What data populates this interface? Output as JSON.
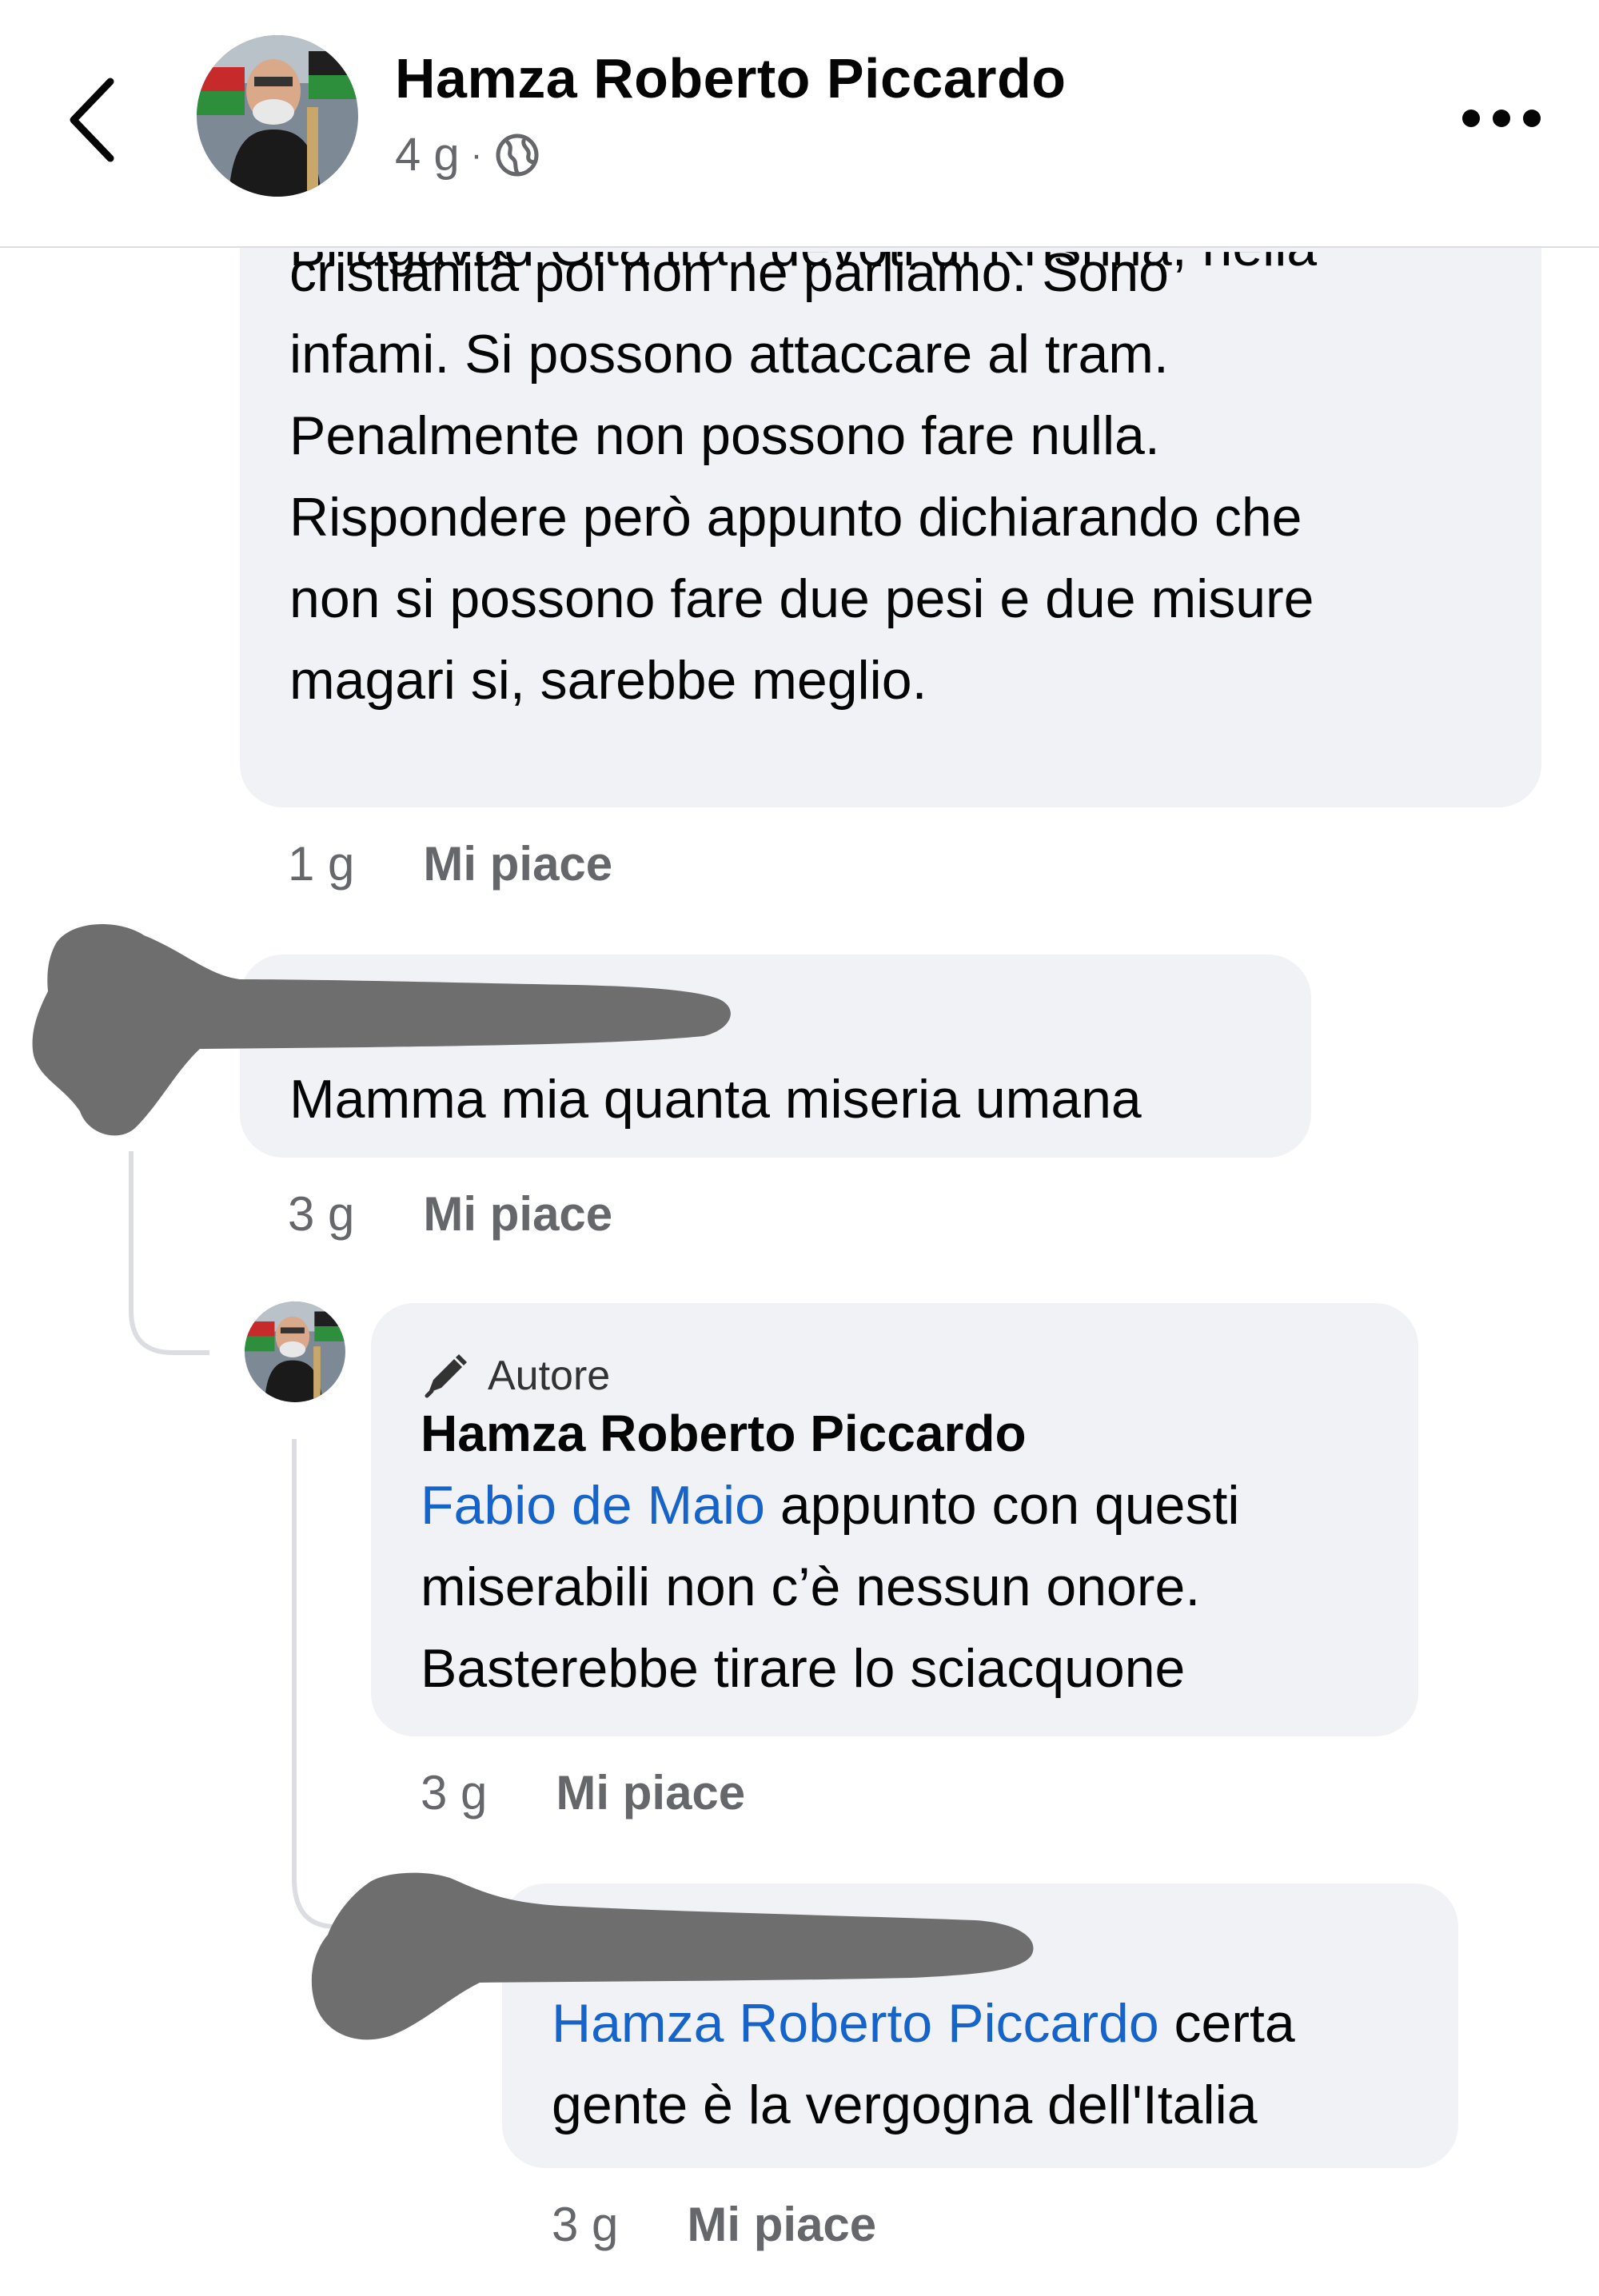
{
  "header": {
    "author_name": "Hamza Roberto Piccardo",
    "time": "4 g",
    "separator": "·",
    "back_icon": "chevron-left-icon",
    "privacy_icon": "globe-icon",
    "more_icon": "more-horizontal-icon"
  },
  "comments": [
    {
      "cut_line": "Bhagavad Gita tra i devoti di Krishna, nella",
      "lines": [
        "cristianità poi non ne parliamo.  Sono",
        "infami. Si possono attaccare al tram.",
        "Penalmente non possono fare nulla.",
        "Rispondere però appunto dichiarando che",
        "non si possono fare due pesi e due misure",
        "magari si, sarebbe meglio."
      ],
      "time": "1 g",
      "like_label": "Mi piace"
    },
    {
      "author_redacted": true,
      "lines": [
        "Mamma mia quanta miseria umana"
      ],
      "time": "3 g",
      "like_label": "Mi piace"
    },
    {
      "badge_icon": "pen-icon",
      "badge_label": "Autore",
      "author": "Hamza Roberto Piccardo",
      "mention": "Fabio de Maio",
      "first_line_rest": " appunto con questi",
      "lines": [
        "miserabili non c’è nessun onore.",
        "Basterebbe tirare lo sciacquone"
      ],
      "time": "3 g",
      "like_label": "Mi piace"
    },
    {
      "author_redacted": true,
      "mention": "Hamza Roberto Piccardo",
      "first_line_rest": " certa",
      "lines": [
        "gente è la vergogna dell'Italia"
      ],
      "time": "3 g",
      "like_label": "Mi piace"
    }
  ],
  "colors": {
    "bubble": "#f0f2f5",
    "link": "#1664c9",
    "meta": "#65676b",
    "redaction": "#6e6e6e"
  }
}
